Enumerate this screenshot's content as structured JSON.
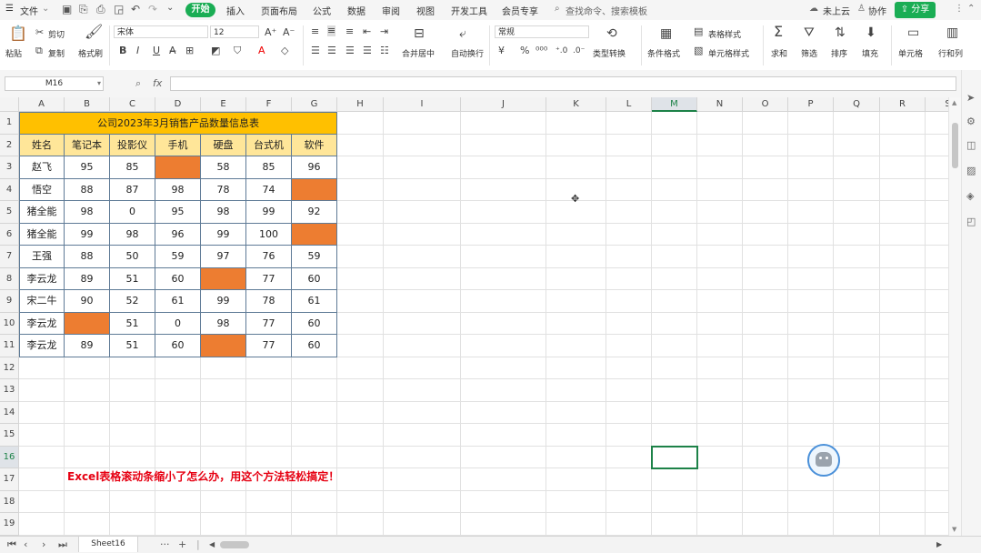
{
  "menubar": {
    "file": "文件",
    "tabs": [
      "开始",
      "插入",
      "页面布局",
      "公式",
      "数据",
      "审阅",
      "视图",
      "开发工具",
      "会员专享"
    ],
    "search_placeholder": "查找命令、搜索模板",
    "cloud": "未上云",
    "collab": "协作",
    "share": "分享"
  },
  "ribbon": {
    "paste": "粘贴",
    "cut": "剪切",
    "copy": "复制",
    "format_painter": "格式刷",
    "font_name": "宋体",
    "font_size": "12",
    "number_format": "常规",
    "merge": "合并居中",
    "wrap": "自动换行",
    "type_convert": "类型转换",
    "cond_format": "条件格式",
    "table_style": "表格样式",
    "cell_style": "单元格样式",
    "sum": "求和",
    "filter": "筛选",
    "sort": "排序",
    "fill": "填充",
    "cell": "单元格",
    "row_col": "行和列"
  },
  "formula_bar": {
    "name_box": "M16",
    "fx": "fx",
    "value": ""
  },
  "columns": [
    "A",
    "B",
    "C",
    "D",
    "E",
    "F",
    "G",
    "H",
    "I",
    "J",
    "K",
    "L",
    "M",
    "N",
    "O",
    "P",
    "Q",
    "R",
    "S"
  ],
  "rows": [
    "1",
    "2",
    "3",
    "4",
    "5",
    "6",
    "7",
    "8",
    "9",
    "10",
    "11",
    "12",
    "13",
    "14",
    "15",
    "16",
    "17",
    "18",
    "19"
  ],
  "table": {
    "title": "公司2023年3月销售产品数量信息表",
    "headers": [
      "姓名",
      "笔记本",
      "投影仪",
      "手机",
      "硬盘",
      "台式机",
      "软件"
    ],
    "rows": [
      [
        "赵飞",
        "95",
        "85",
        "",
        "58",
        "85",
        "96"
      ],
      [
        "悟空",
        "88",
        "87",
        "98",
        "78",
        "74",
        ""
      ],
      [
        "猪全能",
        "98",
        "0",
        "95",
        "98",
        "99",
        "92"
      ],
      [
        "猪全能",
        "99",
        "98",
        "96",
        "99",
        "100",
        ""
      ],
      [
        "王强",
        "88",
        "50",
        "59",
        "97",
        "76",
        "59"
      ],
      [
        "李云龙",
        "89",
        "51",
        "60",
        "",
        "77",
        "60"
      ],
      [
        "宋二牛",
        "90",
        "52",
        "61",
        "99",
        "78",
        "61"
      ],
      [
        "李云龙",
        "",
        "51",
        "0",
        "98",
        "77",
        "60"
      ],
      [
        "李云龙",
        "89",
        "51",
        "60",
        "",
        "77",
        "60"
      ]
    ],
    "highlighted": [
      [
        0,
        3
      ],
      [
        1,
        6
      ],
      [
        3,
        6
      ],
      [
        5,
        4
      ],
      [
        7,
        1
      ],
      [
        8,
        4
      ]
    ],
    "highlight_color": "#ed7d31",
    "title_color": "#ffc000",
    "header_color": "#ffe699"
  },
  "caption": "Excel表格滚动条缩小了怎么办，用这个方法轻松搞定！",
  "sheetbar": {
    "sheet_name": "Sheet16",
    "more": "···",
    "add": "+"
  }
}
